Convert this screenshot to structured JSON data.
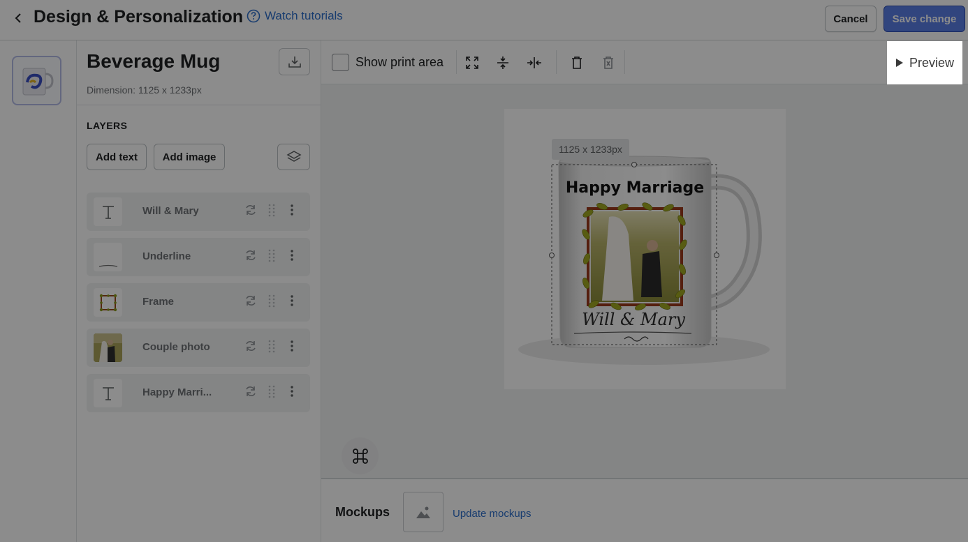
{
  "header": {
    "title": "Design & Personalization",
    "tutorials_label": "Watch tutorials",
    "cancel_label": "Cancel",
    "save_label": "Save change"
  },
  "product": {
    "title": "Beverage Mug",
    "dimension": "Dimension: 1125 x 1233px"
  },
  "layers": {
    "heading": "LAYERS",
    "add_text_label": "Add text",
    "add_image_label": "Add image",
    "items": [
      {
        "label": "Will & Mary",
        "type": "text"
      },
      {
        "label": "Underline",
        "type": "image"
      },
      {
        "label": "Frame",
        "type": "image"
      },
      {
        "label": "Couple photo",
        "type": "image"
      },
      {
        "label": "Happy Marri...",
        "type": "text"
      }
    ]
  },
  "toolbar": {
    "show_print_area_label": "Show print area",
    "show_print_area_checked": false,
    "preview_label": "Preview"
  },
  "canvas": {
    "dimension_tag": "1125 x 1233px",
    "mug_text_top": "Happy Marriage",
    "mug_text_bottom": "Will & Mary"
  },
  "mockups": {
    "label": "Mockups",
    "update_label": "Update mockups"
  },
  "colors": {
    "accent": "#2c6ecb",
    "primary_button": "#5a7ee6",
    "overlay": "#000000"
  }
}
